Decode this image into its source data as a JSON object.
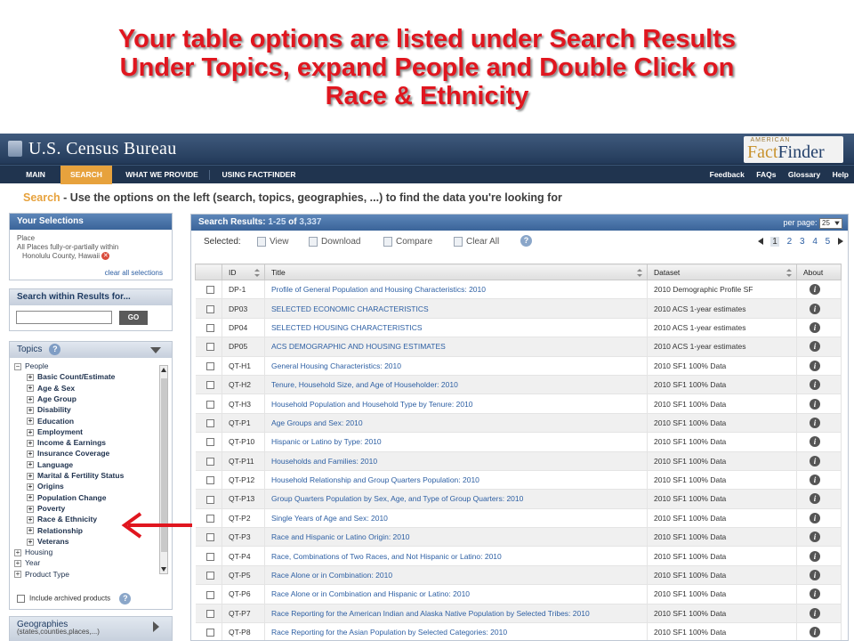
{
  "instruction": {
    "line1": "Your table options are listed under Search Results",
    "line2": "Under Topics, expand People and Double Click on",
    "line3": "Race & Ethnicity"
  },
  "header": {
    "agency": "U.S. Census Bureau",
    "ff_small": "AMERICAN",
    "ff_fact": "Fact",
    "ff_finder": "Finder",
    "brand_color": "#e7a23d"
  },
  "nav": {
    "items": [
      "MAIN",
      "SEARCH",
      "WHAT WE PROVIDE",
      "USING FACTFINDER"
    ],
    "active": "SEARCH",
    "right_links": [
      "Feedback",
      "FAQs",
      "Glossary",
      "Help"
    ]
  },
  "hint": {
    "keyword": "Search",
    "text": " - Use the options on the left (search, topics, geographies, ...) to find the data you're looking for"
  },
  "selections": {
    "title": "Your Selections",
    "label": "Place",
    "value1": "All Places fully-or-partially within",
    "value2": "Honolulu County, Hawaii",
    "clear": "clear all selections"
  },
  "search_within": {
    "title": "Search within Results for...",
    "value": "",
    "go": "GO"
  },
  "topics": {
    "title": "Topics",
    "help": "?",
    "people": "People",
    "people_children": [
      "Basic Count/Estimate",
      "Age & Sex",
      "Age Group",
      "Disability",
      "Education",
      "Employment",
      "Income & Earnings",
      "Insurance Coverage",
      "Language",
      "Marital & Fertility Status",
      "Origins",
      "Population Change",
      "Poverty",
      "Race & Ethnicity",
      "Relationship",
      "Veterans"
    ],
    "others": [
      "Housing",
      "Year",
      "Product Type"
    ],
    "archived": "Include archived products"
  },
  "geographies": {
    "title": "Geographies",
    "sub": "(states,counties,places,...)"
  },
  "results": {
    "title_prefix": "Search Results:",
    "range": "1-25",
    "of": "of",
    "total": "3,337",
    "per_page_label": "per page:",
    "per_page": "25",
    "selected": "Selected:",
    "actions": [
      "View",
      "Download",
      "Compare",
      "Clear All"
    ],
    "pages": [
      "1",
      "2",
      "3",
      "4",
      "5"
    ],
    "current_page": "1",
    "columns": [
      "ID",
      "Title",
      "Dataset",
      "About"
    ],
    "rows": [
      [
        "DP-1",
        "Profile of General Population and Housing Characteristics: 2010",
        "2010 Demographic Profile SF"
      ],
      [
        "DP03",
        "SELECTED ECONOMIC CHARACTERISTICS",
        "2010 ACS 1-year estimates"
      ],
      [
        "DP04",
        "SELECTED HOUSING CHARACTERISTICS",
        "2010 ACS 1-year estimates"
      ],
      [
        "DP05",
        "ACS DEMOGRAPHIC AND HOUSING ESTIMATES",
        "2010 ACS 1-year estimates"
      ],
      [
        "QT-H1",
        "General Housing Characteristics: 2010",
        "2010 SF1 100% Data"
      ],
      [
        "QT-H2",
        "Tenure, Household Size, and Age of Householder: 2010",
        "2010 SF1 100% Data"
      ],
      [
        "QT-H3",
        "Household Population and Household Type by Tenure: 2010",
        "2010 SF1 100% Data"
      ],
      [
        "QT-P1",
        "Age Groups and Sex: 2010",
        "2010 SF1 100% Data"
      ],
      [
        "QT-P10",
        "Hispanic or Latino by Type: 2010",
        "2010 SF1 100% Data"
      ],
      [
        "QT-P11",
        "Households and Families: 2010",
        "2010 SF1 100% Data"
      ],
      [
        "QT-P12",
        "Household Relationship and Group Quarters Population: 2010",
        "2010 SF1 100% Data"
      ],
      [
        "QT-P13",
        "Group Quarters Population by Sex, Age, and Type of Group Quarters: 2010",
        "2010 SF1 100% Data"
      ],
      [
        "QT-P2",
        "Single Years of Age and Sex: 2010",
        "2010 SF1 100% Data"
      ],
      [
        "QT-P3",
        "Race and Hispanic or Latino Origin: 2010",
        "2010 SF1 100% Data"
      ],
      [
        "QT-P4",
        "Race, Combinations of Two Races, and Not Hispanic or Latino: 2010",
        "2010 SF1 100% Data"
      ],
      [
        "QT-P5",
        "Race Alone or in Combination: 2010",
        "2010 SF1 100% Data"
      ],
      [
        "QT-P6",
        "Race Alone or in Combination and Hispanic or Latino: 2010",
        "2010 SF1 100% Data"
      ],
      [
        "QT-P7",
        "Race Reporting for the American Indian and Alaska Native Population by Selected Tribes: 2010",
        "2010 SF1 100% Data"
      ],
      [
        "QT-P8",
        "Race Reporting for the Asian Population by Selected Categories: 2010",
        "2010 SF1 100% Data"
      ]
    ]
  }
}
